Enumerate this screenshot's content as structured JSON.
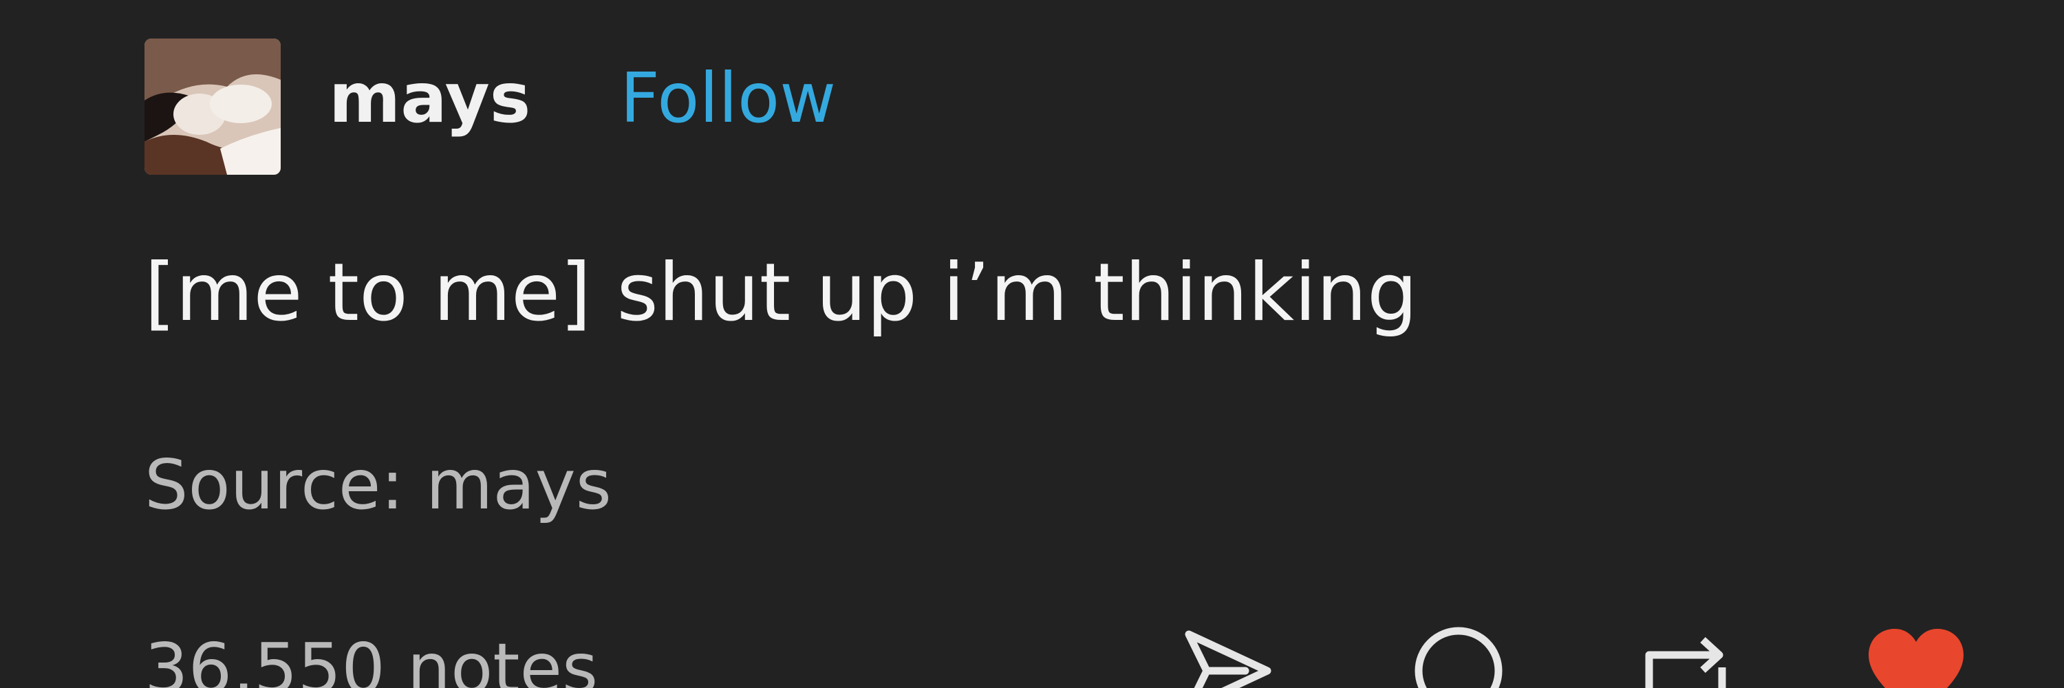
{
  "post": {
    "username": "mays",
    "follow_label": "Follow",
    "body": "[me to me] shut up i’m thinking",
    "source_prefix": "Source: ",
    "source_name": "mays",
    "notes": "36,550 notes"
  },
  "actions": [
    {
      "icon": "share-icon"
    },
    {
      "icon": "reply-icon"
    },
    {
      "icon": "reblog-icon"
    },
    {
      "icon": "heart-icon"
    }
  ],
  "colors": {
    "background": "#222222",
    "text": "#f2f2f2",
    "muted": "#b9b9b9",
    "follow": "#34a9df",
    "like": "#e8462d"
  }
}
